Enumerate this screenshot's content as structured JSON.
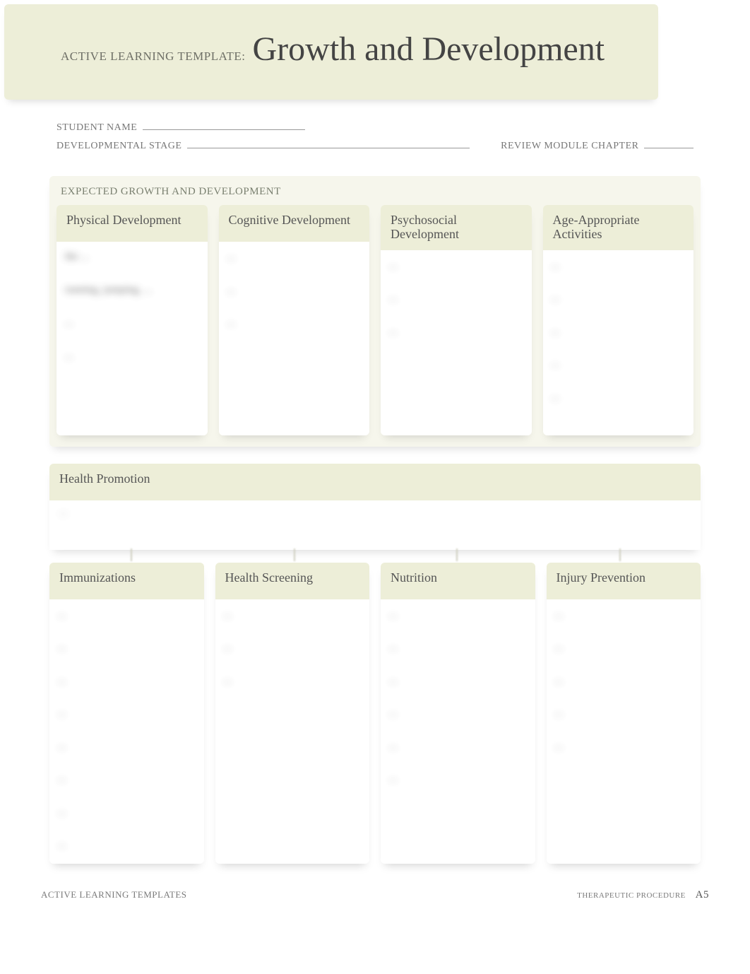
{
  "banner": {
    "prefix": "ACTIVE LEARNING TEMPLATE:",
    "title": "Growth and Development"
  },
  "meta": {
    "student_label": "STUDENT NAME",
    "stage_label": "DEVELOPMENTAL STAGE",
    "chapter_label": "REVIEW MODULE CHAPTER"
  },
  "expected": {
    "label": "EXPECTED GROWTH AND DEVELOPMENT",
    "cards": {
      "physical": {
        "title": "Physical Development",
        "body": "the ...\n\nrunning, jumping, ...\n\n...\n\n..."
      },
      "cognitive": {
        "title": "Cognitive Development",
        "body": "...\n\n...\n\n..."
      },
      "psychosocial": {
        "title": "Psychosocial Development",
        "body": "...\n\n...\n\n..."
      },
      "activities": {
        "title": "Age-Appropriate Activities",
        "body": "...\n\n...\n\n...\n\n...\n\n..."
      }
    }
  },
  "promo": {
    "title": "Health Promotion",
    "body": "..."
  },
  "promo_children": {
    "immunizations": {
      "title": "Immunizations",
      "body": "...\n\n...\n\n...\n\n...\n\n...\n\n...\n\n...\n\n..."
    },
    "screening": {
      "title": "Health Screening",
      "body": "...\n\n...\n\n..."
    },
    "nutrition": {
      "title": "Nutrition",
      "body": "...\n\n...\n\n...\n\n...\n\n...\n\n..."
    },
    "injury": {
      "title": "Injury Prevention",
      "body": "...\n\n...\n\n...\n\n...\n\n..."
    }
  },
  "footer": {
    "left": "ACTIVE LEARNING TEMPLATES",
    "proc": "THERAPEUTIC PROCEDURE",
    "page": "A5"
  }
}
